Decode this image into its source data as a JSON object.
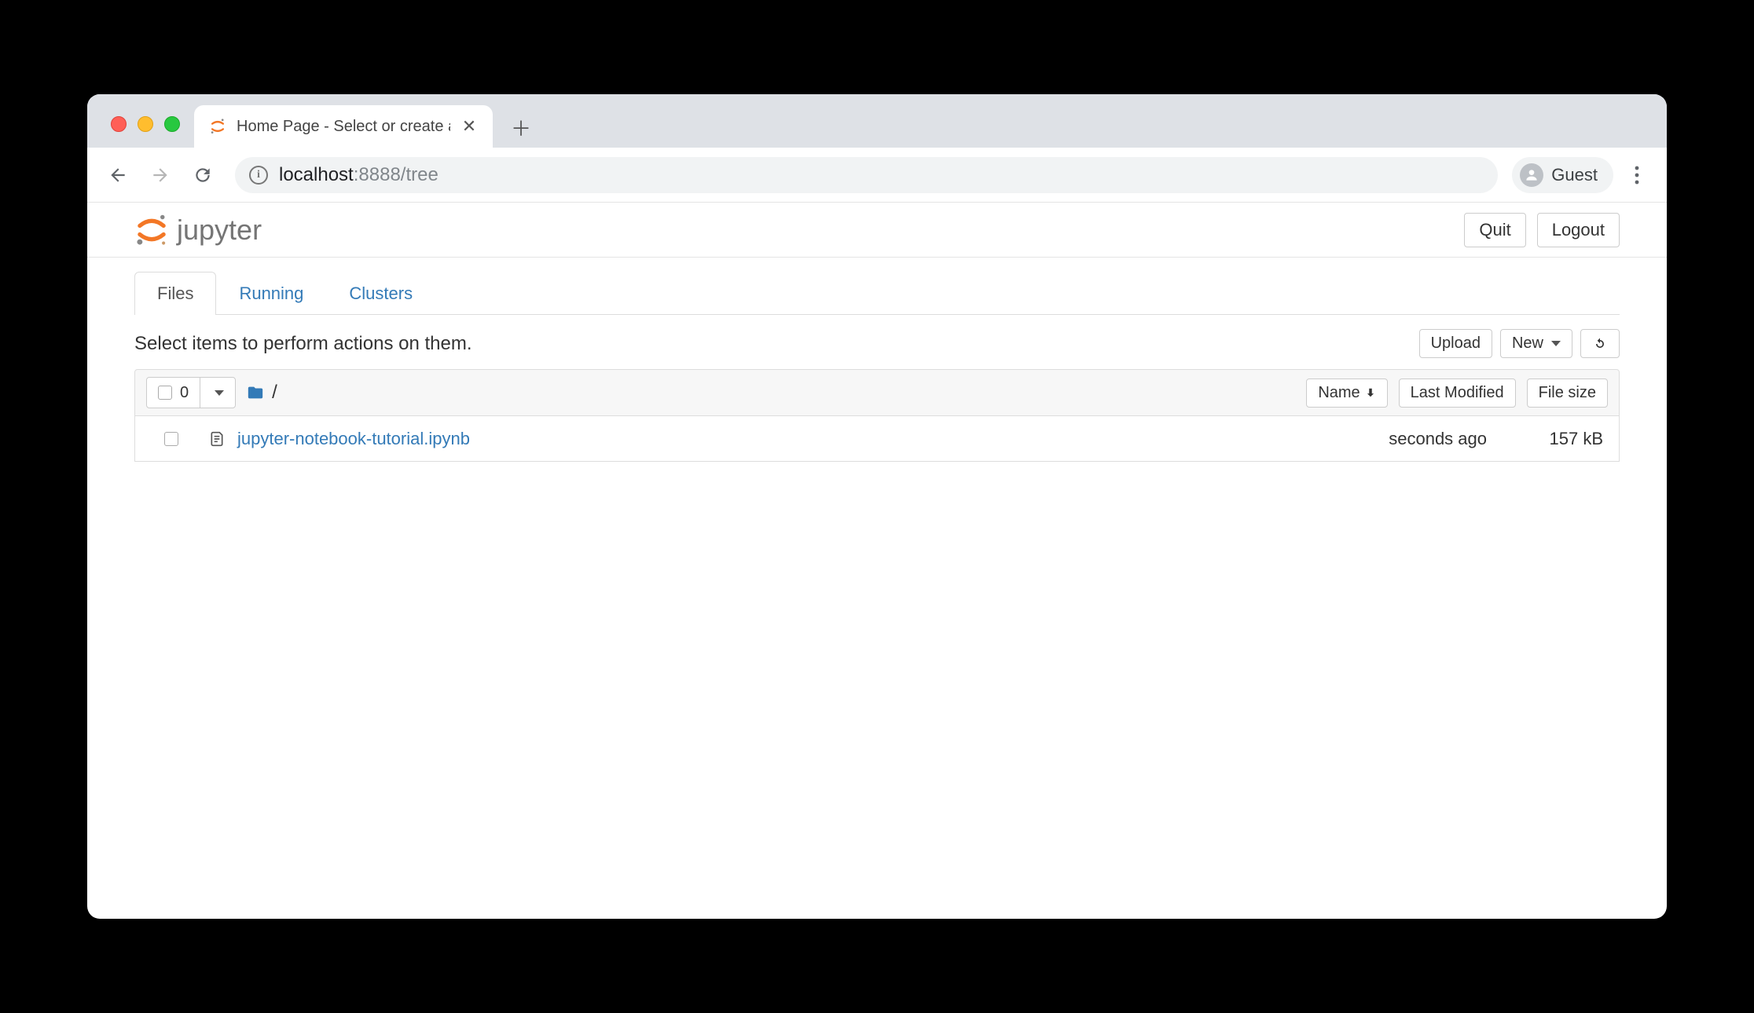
{
  "browser": {
    "tab_title": "Home Page - Select or create a n",
    "url_host": "localhost",
    "url_port": ":8888",
    "url_path": "/tree",
    "guest_label": "Guest"
  },
  "header": {
    "logo_text": "jupyter",
    "quit_label": "Quit",
    "logout_label": "Logout"
  },
  "tabs": {
    "files": "Files",
    "running": "Running",
    "clusters": "Clusters"
  },
  "actions_row": {
    "hint": "Select items to perform actions on them.",
    "upload_label": "Upload",
    "new_label": "New"
  },
  "list_header": {
    "selected_count": "0",
    "breadcrumb": "/",
    "name_col": "Name",
    "modified_col": "Last Modified",
    "size_col": "File size"
  },
  "files": [
    {
      "name": "jupyter-notebook-tutorial.ipynb",
      "modified": "seconds ago",
      "size": "157 kB"
    }
  ]
}
